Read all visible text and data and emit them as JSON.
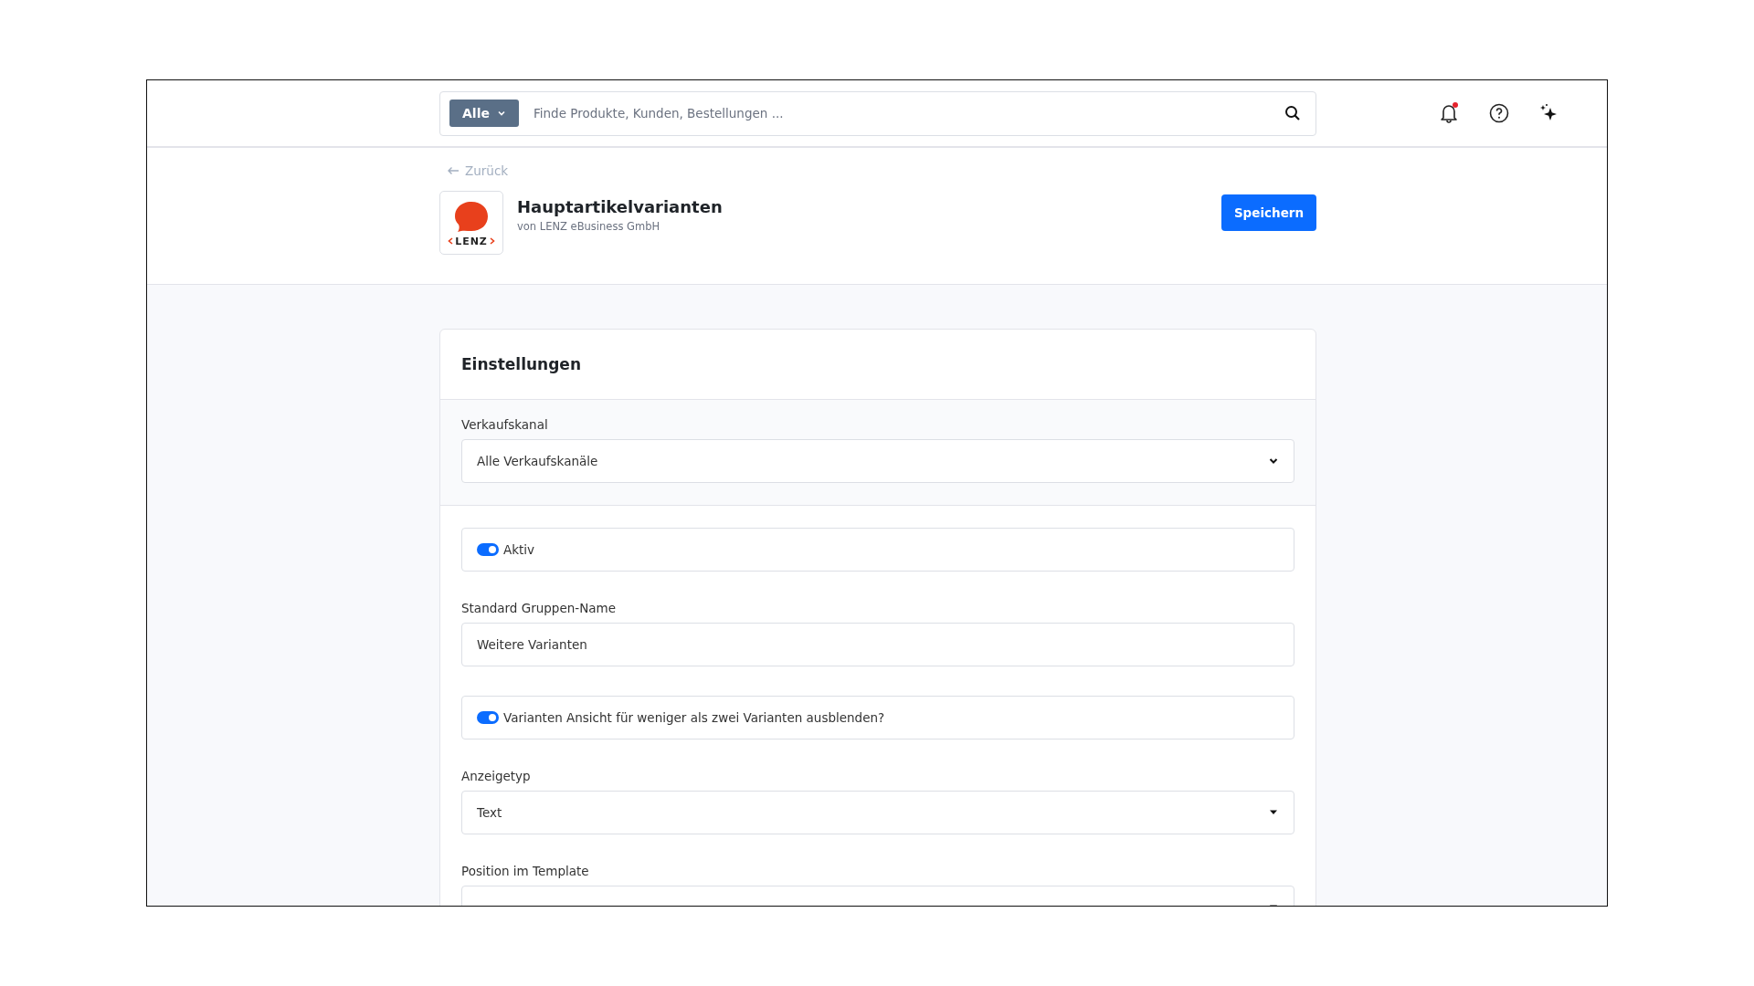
{
  "search": {
    "scope": "Alle",
    "placeholder": "Finde Produkte, Kunden, Bestellungen ..."
  },
  "topbar": {
    "notification_dot": true
  },
  "back_link": "Zurück",
  "app": {
    "title": "Hauptartikelvarianten",
    "vendor": "von LENZ eBusiness GmbH",
    "logo_text": "LENZ"
  },
  "save_button": "Speichern",
  "card": {
    "title": "Einstellungen",
    "channel": {
      "label": "Verkaufskanal",
      "value": "Alle Verkaufskanäle"
    },
    "fields": [
      {
        "kind": "toggle",
        "label": "Aktiv",
        "on": true
      },
      {
        "kind": "text",
        "label": "Standard Gruppen-Name",
        "value": "Weitere Varianten"
      },
      {
        "kind": "toggle",
        "label": "Varianten Ansicht für weniger als zwei Varianten ausblenden?",
        "on": true
      },
      {
        "kind": "select",
        "label": "Anzeigetyp",
        "value": "Text"
      },
      {
        "kind": "select",
        "label": "Position im Template"
      }
    ]
  }
}
